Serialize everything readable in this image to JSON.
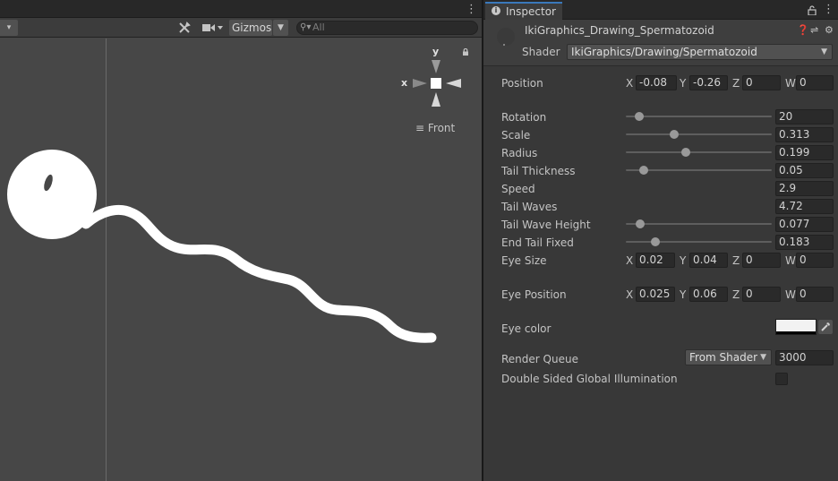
{
  "scene": {
    "toolbar": {
      "gizmos_label": "Gizmos",
      "search_placeholder": "All"
    },
    "orientation": {
      "view_label": "Front",
      "axis_x": "x",
      "axis_y": "y"
    }
  },
  "inspector": {
    "tab_label": "Inspector",
    "material_name": "IkiGraphics_Drawing_Spermatozoid",
    "shader_label": "Shader",
    "shader_value": "IkiGraphics/Drawing/Spermatozoid",
    "properties": {
      "position": {
        "label": "Position",
        "x": "-0.08",
        "y": "-0.26",
        "z": "0",
        "w": "0"
      },
      "rotation": {
        "label": "Rotation",
        "value": "20",
        "fraction": 0.09
      },
      "scale": {
        "label": "Scale",
        "value": "0.313",
        "fraction": 0.33
      },
      "radius": {
        "label": "Radius",
        "value": "0.199",
        "fraction": 0.41
      },
      "tail_thickness": {
        "label": "Tail Thickness",
        "value": "0.05",
        "fraction": 0.12
      },
      "speed": {
        "label": "Speed",
        "value": "2.9"
      },
      "tail_waves": {
        "label": "Tail Waves",
        "value": "4.72"
      },
      "tail_wave_height": {
        "label": "Tail Wave Height",
        "value": "0.077",
        "fraction": 0.1
      },
      "end_tail_fixed": {
        "label": "End Tail Fixed",
        "value": "0.183",
        "fraction": 0.2
      },
      "eye_size": {
        "label": "Eye Size",
        "x": "0.02",
        "y": "0.04",
        "z": "0",
        "w": "0"
      },
      "eye_position": {
        "label": "Eye Position",
        "x": "0.025",
        "y": "0.06",
        "z": "0",
        "w": "0"
      },
      "eye_color": {
        "label": "Eye color",
        "color": "#f2f2f2"
      },
      "render_queue": {
        "label": "Render Queue",
        "mode": "From Shader",
        "value": "3000"
      },
      "double_sided_gi": {
        "label": "Double Sided Global Illumination",
        "checked": false
      }
    },
    "vector_axes": {
      "x": "X",
      "y": "Y",
      "z": "Z",
      "w": "W"
    }
  },
  "colors": {
    "accent": "#3a79bb",
    "scene_bg": "#474747",
    "panel_bg": "#383838",
    "shape": "#ffffff"
  }
}
